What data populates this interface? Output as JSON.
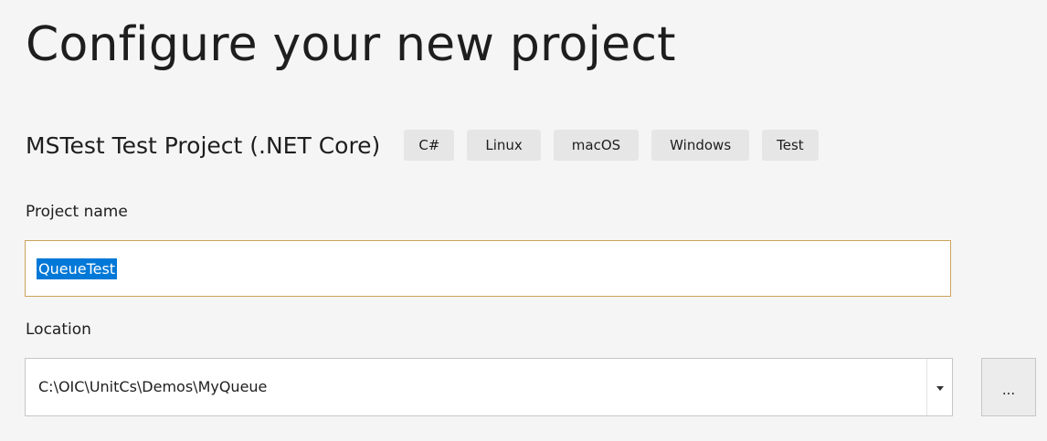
{
  "page": {
    "title": "Configure your new project"
  },
  "template": {
    "name": "MSTest Test Project (.NET Core)",
    "tags": [
      "C#",
      "Linux",
      "macOS",
      "Windows",
      "Test"
    ]
  },
  "project_name": {
    "label": "Project name",
    "value": "QueueTest",
    "selected": true
  },
  "location": {
    "label": "Location",
    "value": "C:\\OIC\\UnitCs\\Demos\\MyQueue",
    "dropdown_icon": "chevron-down-icon",
    "browse_label": "..."
  },
  "colors": {
    "selection": "#0078d7",
    "focus_border": "#cba35c",
    "tag_background": "#e6e6e6"
  }
}
